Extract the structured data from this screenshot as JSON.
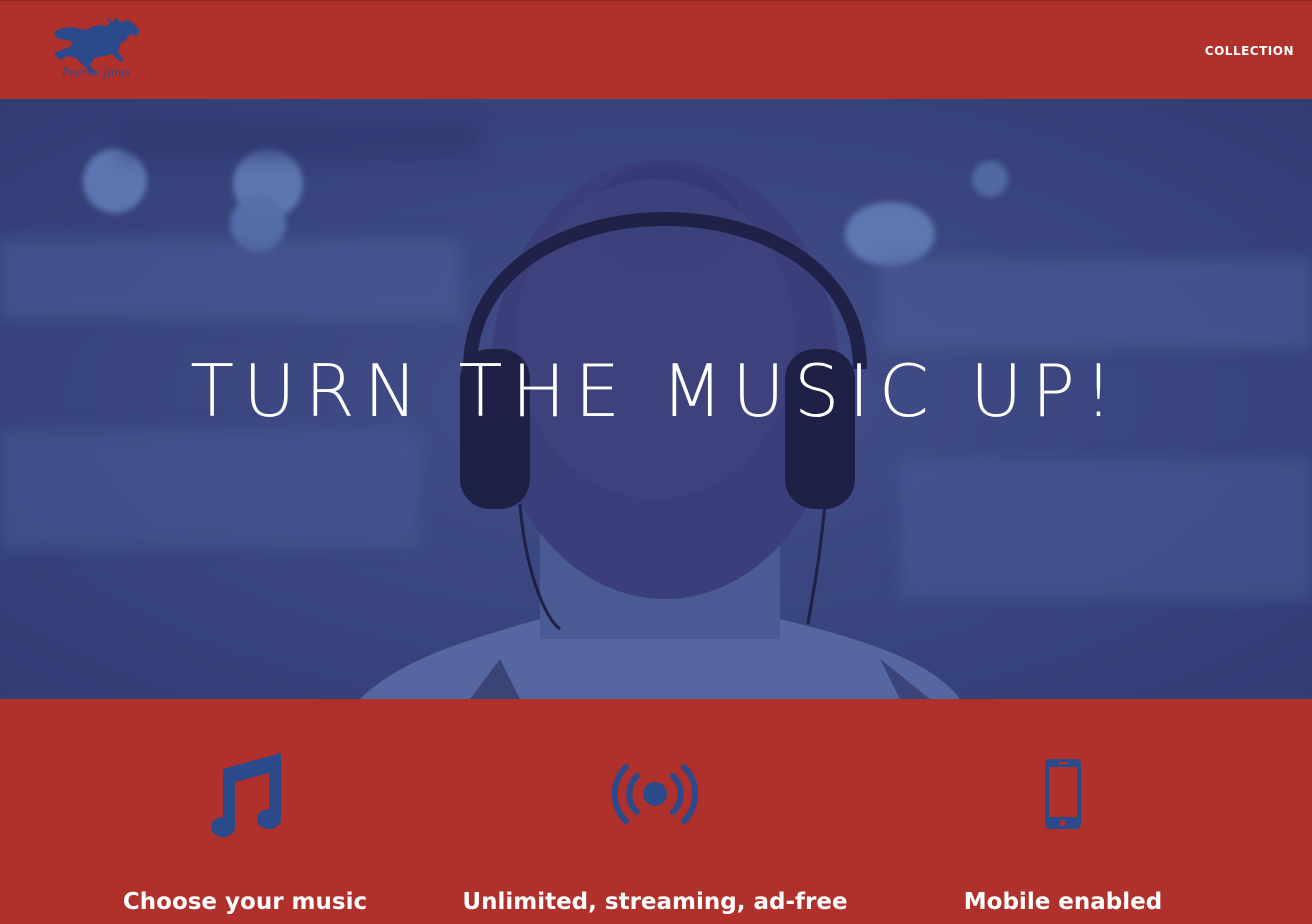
{
  "navbar": {
    "logo_text": "Pearce Jams",
    "links": [
      {
        "label": "COLLECTION"
      }
    ]
  },
  "hero": {
    "title": "TURN THE MUSIC UP!"
  },
  "features": [
    {
      "icon": "music-note-icon",
      "label": "Choose your music"
    },
    {
      "icon": "broadcast-icon",
      "label": "Unlimited, streaming, ad-free"
    },
    {
      "icon": "mobile-phone-icon",
      "label": "Mobile enabled"
    }
  ],
  "colors": {
    "brand_red": "#b0302b",
    "icon_blue": "#2a4a8c",
    "hero_overlay": "#3d4a82",
    "text_white": "#ffffff"
  }
}
